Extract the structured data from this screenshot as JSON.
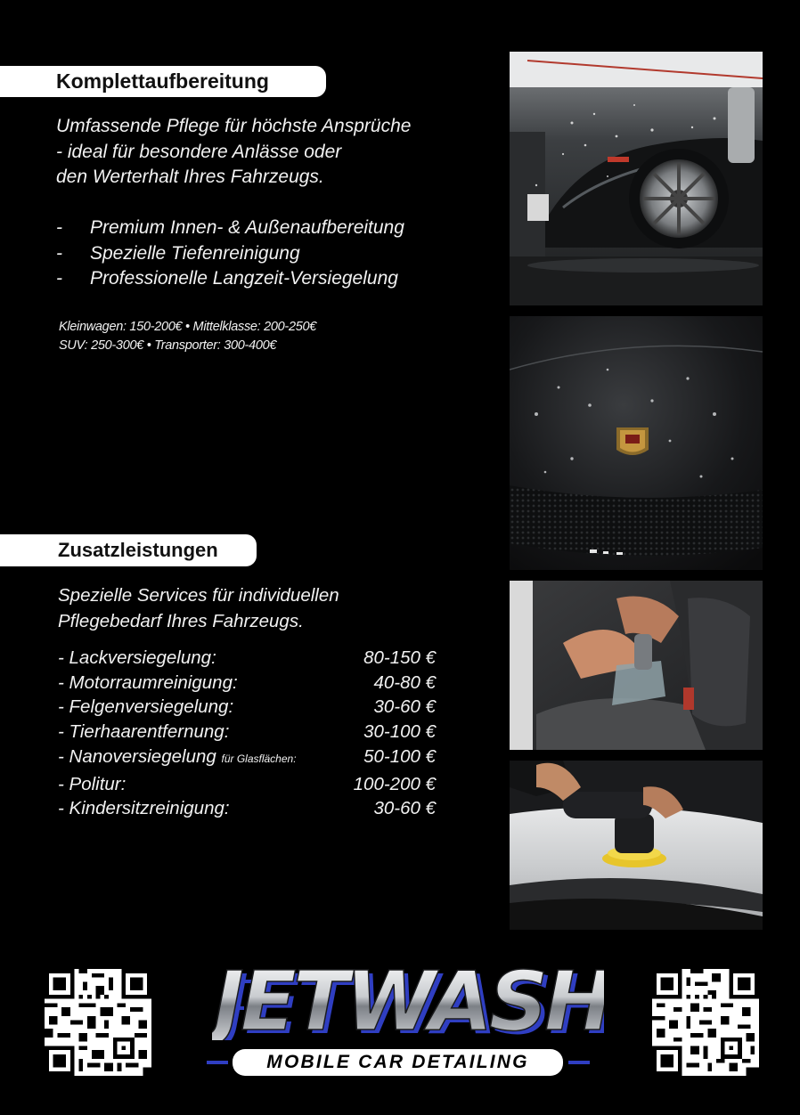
{
  "section1": {
    "title": "Komplettaufbereitung",
    "intro": [
      "Umfassende Pflege für höchste Ansprüche",
      "- ideal für besondere Anlässe oder",
      "den Werterhalt Ihres Fahrzeugs."
    ],
    "features": [
      {
        "dash": "-",
        "text": "Premium Innen- & Außenaufbereitung"
      },
      {
        "dash": "-",
        "text": "Spezielle Tiefenreinigung"
      },
      {
        "dash": "-",
        "text": "Professionelle Langzeit-Versiegelung"
      }
    ],
    "prices": [
      "Kleinwagen: 150-200€ • Mittelklasse: 200-250€",
      "SUV: 250-300€ • Transporter: 300-400€"
    ]
  },
  "section2": {
    "title": "Zusatzleistungen",
    "intro": [
      "Spezielle Services für individuellen",
      "Pflegebedarf Ihres Fahrzeugs."
    ],
    "items": [
      {
        "label": "- Lackversiegelung:",
        "note": "",
        "price": "80-150 €"
      },
      {
        "label": "- Motorraumreinigung:",
        "note": "",
        "price": "40-80 €"
      },
      {
        "label": "- Felgenversiegelung:",
        "note": "",
        "price": "30-60 €"
      },
      {
        "label": "- Tierhaarentfernung:",
        "note": "",
        "price": "30-100 €"
      },
      {
        "label": "- Nanoversiegelung",
        "note": "für Glasflächen:",
        "price": "50-100 €"
      },
      {
        "label": "- Politur:",
        "note": "",
        "price": "100-200 €"
      },
      {
        "label": "- Kindersitzreinigung:",
        "note": "",
        "price": "30-60 €"
      }
    ]
  },
  "logo": {
    "word": "JETWASH",
    "tagline": "MOBILE CAR DETAILING",
    "accent": "#2f3ec2"
  },
  "photos": [
    "car-wash-foam-photo",
    "porsche-hood-badge-photo",
    "interior-seat-cleaning-photo",
    "paint-polishing-photo"
  ],
  "colors": {
    "background": "#000000",
    "text": "#ffffff",
    "pill": "#ffffff"
  }
}
